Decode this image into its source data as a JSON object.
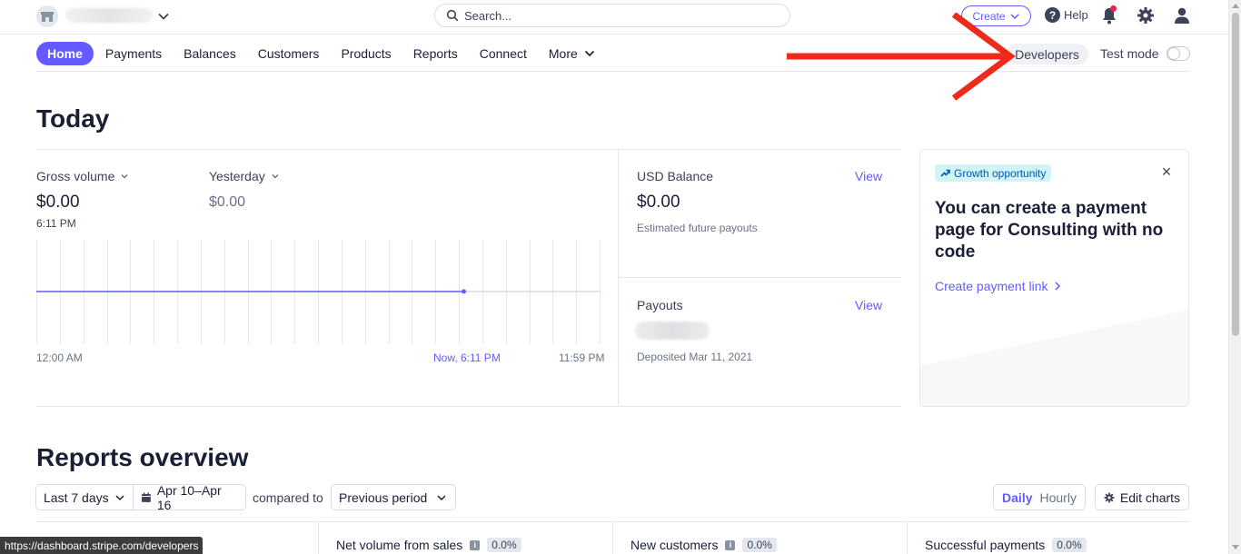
{
  "topbar": {
    "search_placeholder": "Search...",
    "create_label": "Create",
    "help_label": "Help",
    "help_glyph": "?",
    "notifications_unread": true
  },
  "nav": {
    "items": [
      "Home",
      "Payments",
      "Balances",
      "Customers",
      "Products",
      "Reports",
      "Connect",
      "More"
    ],
    "active": "Home",
    "developers_label": "Developers",
    "test_mode_label": "Test mode",
    "test_mode_on": false
  },
  "today": {
    "title": "Today",
    "gross_volume": {
      "label": "Gross volume",
      "value": "$0.00",
      "time": "6:11 PM"
    },
    "yesterday": {
      "label": "Yesterday",
      "value": "$0.00"
    },
    "chart": {
      "start_label": "12:00 AM",
      "now_label": "Now, 6:11 PM",
      "end_label": "11:59 PM"
    },
    "usd_balance": {
      "label": "USD Balance",
      "view_label": "View",
      "value": "$0.00",
      "sub": "Estimated future payouts"
    },
    "payouts": {
      "label": "Payouts",
      "view_label": "View",
      "sub": "Deposited Mar 11, 2021"
    }
  },
  "chart_data": {
    "type": "line",
    "x": [
      "12:00 AM",
      "Now, 6:11 PM",
      "11:59 PM"
    ],
    "series": [
      {
        "values": [
          0,
          0
        ]
      }
    ],
    "ylim": [
      0,
      0
    ],
    "grid": true
  },
  "growth_card": {
    "badge": "Growth opportunity",
    "close_glyph": "×",
    "title": "You can create a payment page for Consulting with no code",
    "link": "Create payment link"
  },
  "reports": {
    "title": "Reports overview",
    "range_label": "Last 7 days",
    "date_range": "Apr 10–Apr 16",
    "compared_to": "compared to",
    "comparison": "Previous period",
    "daily_label": "Daily",
    "hourly_label": "Hourly",
    "edit_charts_label": "Edit charts",
    "metrics": [
      {
        "label": "Net volume from sales",
        "pct": "0.0%"
      },
      {
        "label": "New customers",
        "pct": "0.0%"
      },
      {
        "label": "Successful payments",
        "pct": "0.0%"
      }
    ],
    "info_glyph": "i"
  },
  "status_url": "https://dashboard.stripe.com/developers",
  "colors": {
    "accent": "#635bff",
    "annotation_arrow": "#ee2a1b",
    "line": "#635bff"
  }
}
